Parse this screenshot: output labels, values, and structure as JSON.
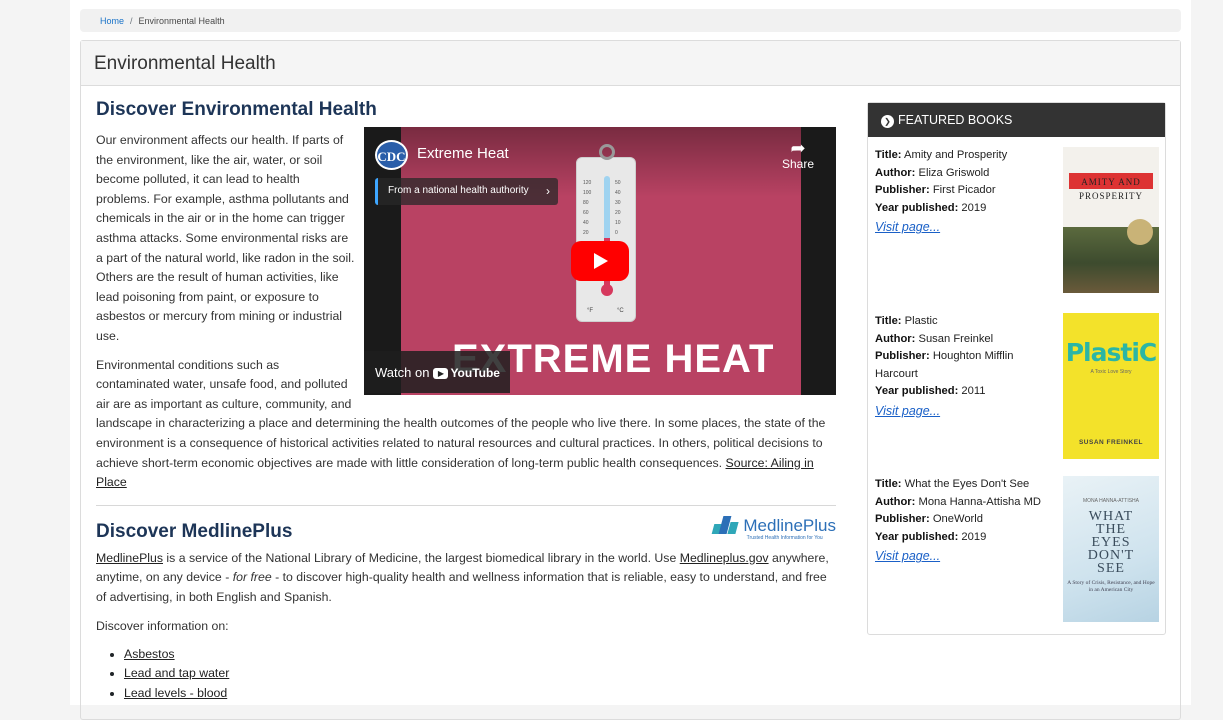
{
  "breadcrumb": {
    "home": "Home",
    "separator": "/",
    "current": "Environmental Health"
  },
  "page_title": "Environmental Health",
  "discover_env": {
    "heading": "Discover Environmental Health",
    "p1": "Our environment affects our health. If parts of the environment, like the air, water, or soil become polluted, it can lead to health problems. For example, asthma pollutants and chemicals in the air or in the home can trigger asthma attacks. Some environmental risks are a part of the natural world, like radon in the soil. Others are the result of human activities, like lead poisoning from paint, or exposure to asbestos or mercury from mining or industrial use.",
    "p2": "Environmental conditions such as contaminated water, unsafe food, and polluted air are as important as culture, community, and landscape in characterizing a place and determining the health outcomes of the people who live there. In some places, the state of the environment is a consequence of historical activities related to natural resources and cultural practices. In others, political decisions to achieve short-term economic objectives are made with little consideration of long-term public health consequences.",
    "source_link": "Source: Ailing in Place"
  },
  "video": {
    "channel_logo": "CDC",
    "title": "Extreme Heat",
    "authority_label": "From a national health authority",
    "authority_chevron": "›",
    "share_label": "Share",
    "big_title": "EXTREME HEAT",
    "watch_on": "Watch on",
    "youtube": "YouTube",
    "thermo_f": "°F",
    "thermo_c": "°C"
  },
  "medline": {
    "heading": "Discover MedlinePlus",
    "logo_text": "MedlinePlus",
    "logo_tagline": "Trusted Health Information for You",
    "p1_link": "MedlinePlus",
    "p1_a": " is a service of the National Library of Medicine, the largest biomedical library in the world. Use ",
    "p1_link2": "Medlineplus.gov",
    "p1_b": " anywhere, anytime, on any device - ",
    "p1_em": "for free",
    "p1_c": " - to discover high-quality health and wellness information that is reliable, easy to understand, and free of advertising, in both English and Spanish.",
    "discover_info": "Discover information on:",
    "topics": [
      "Asbestos",
      "Lead and tap water",
      "Lead levels - blood"
    ]
  },
  "featured": {
    "heading": "FEATURED BOOKS",
    "labels": {
      "title": "Title:",
      "author": "Author:",
      "publisher": "Publisher:",
      "year": "Year published:"
    },
    "visit_label": "Visit page...",
    "books": [
      {
        "title": "Amity and Prosperity",
        "author": "Eliza Griswold",
        "publisher": "First Picador",
        "year": "2019",
        "cover_title": "AMITY AND PROSPERITY"
      },
      {
        "title": "Plastic",
        "author": "Susan Freinkel",
        "publisher": "Houghton Mifflin Harcourt",
        "year": "2011",
        "cover_title": "PlastiC",
        "cover_sub": "A Toxic Love Story",
        "cover_author": "SUSAN FREINKEL"
      },
      {
        "title": "What the Eyes Don't See",
        "author": "Mona Hanna-Attisha MD",
        "publisher": "OneWorld",
        "year": "2019",
        "cover_author": "MONA HANNA-ATTISHA",
        "cover_title_1": "WHAT",
        "cover_title_2": "THE",
        "cover_title_3": "EYES",
        "cover_title_4": "DON'T",
        "cover_title_5": "SEE",
        "cover_sub": "A Story of Crisis, Resistance, and Hope in an American City"
      }
    ]
  },
  "colors": {
    "link": "#1a60c7",
    "heading": "#1d3557",
    "video_bg": "#b94263",
    "youtube_red": "#ff0000"
  }
}
